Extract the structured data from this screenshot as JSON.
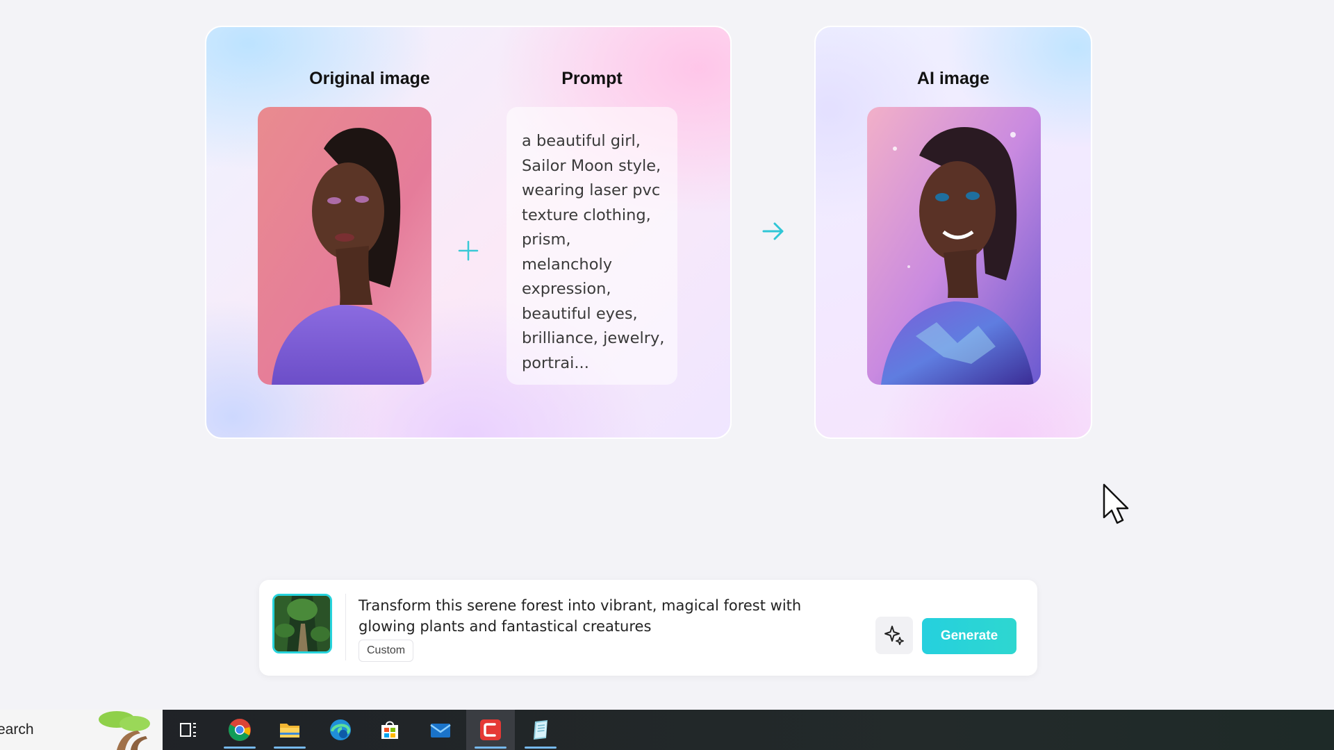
{
  "showcase": {
    "original_title": "Original image",
    "prompt_title": "Prompt",
    "ai_title": "AI image",
    "prompt_text": "a beautiful girl, Sailor Moon style, wearing laser pvc texture clothing, prism, melancholy expression, beautiful eyes, brilliance, jewelry, portrai..."
  },
  "prompt_bar": {
    "text": "Transform this serene forest into vibrant, magical forest with glowing plants and fantastical creatures",
    "tag": "Custom",
    "generate_label": "Generate"
  },
  "taskbar": {
    "search_text": "earch",
    "apps": [
      "task-view-icon",
      "chrome-icon",
      "file-explorer-icon",
      "edge-icon",
      "store-icon",
      "mail-icon",
      "capcut-icon",
      "notepad-icon"
    ]
  },
  "colors": {
    "accent": "#27d3dc",
    "page_background": "#f3f3f7",
    "taskbar": "#202124"
  }
}
